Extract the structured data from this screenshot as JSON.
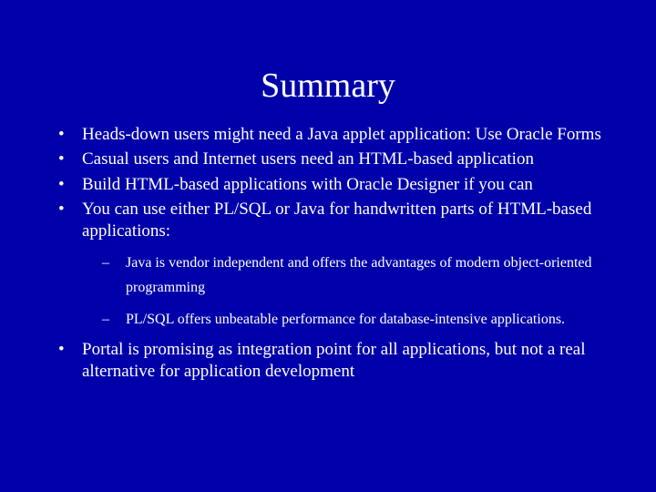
{
  "title": "Summary",
  "bullets": {
    "b1": "Heads-down users might need a Java applet application: Use Oracle Forms",
    "b2": "Casual users and Internet users need an HTML-based application",
    "b3": "Build HTML-based applications with Oracle Designer if you can",
    "b4": "You can use either PL/SQL or Java for handwritten parts of HTML-based applications:",
    "b4_sub1": "Java is vendor independent and offers the advantages of modern object-oriented programming",
    "b4_sub2": "PL/SQL offers unbeatable performance for database-intensive applications.",
    "b5": "Portal is promising as integration point for all applications, but not a real alternative for application development"
  }
}
